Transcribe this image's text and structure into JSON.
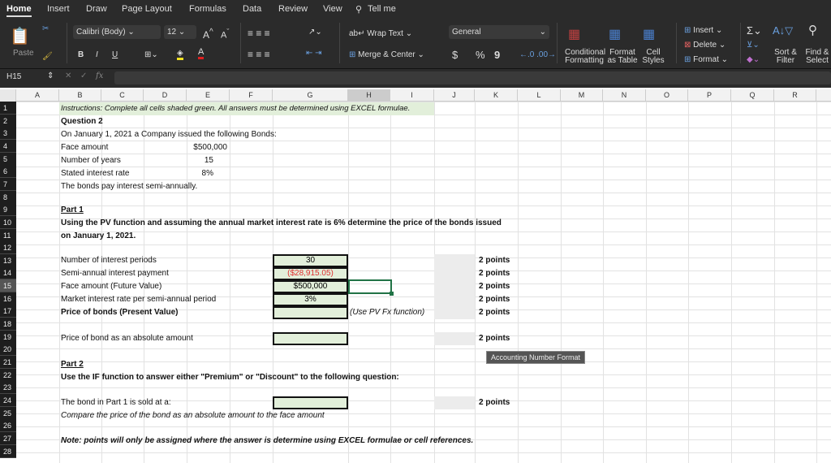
{
  "ribbon": {
    "tabs": [
      "Home",
      "Insert",
      "Draw",
      "Page Layout",
      "Formulas",
      "Data",
      "Review",
      "View"
    ],
    "tell_me": "Tell me",
    "paste": "Paste",
    "font": "Calibri (Body)",
    "size": "12",
    "bold": "B",
    "italic": "I",
    "underline": "U",
    "wrap": "Wrap Text",
    "merge": "Merge & Center",
    "number_format": "General",
    "currency": "$",
    "percent": "%",
    "comma": "9",
    "cond": "Conditional Formatting",
    "fmt_table": "Format as Table",
    "cell_styles": "Cell Styles",
    "insert": "Insert",
    "delete": "Delete",
    "format": "Format",
    "sort": "Sort & Filter",
    "find": "Find & Select"
  },
  "formula_bar": {
    "name_box": "H15",
    "fx": "fx",
    "value": ""
  },
  "columns": [
    "A",
    "B",
    "C",
    "D",
    "E",
    "F",
    "G",
    "H",
    "I",
    "J",
    "K",
    "L",
    "M",
    "N",
    "O",
    "P",
    "Q",
    "R"
  ],
  "selected_cell": "H15",
  "cells": {
    "r1": "Instructions: Complete all cells shaded green. All answers must be determined using EXCEL formulae.",
    "r2": "Question 2",
    "r3": "On January 1, 2021 a Company issued the following Bonds:",
    "r4_label": "Face amount",
    "r4_value": "$500,000",
    "r5_label": "Number of years",
    "r5_value": "15",
    "r6_label": "Stated interest rate",
    "r6_value": "8%",
    "r7": "The bonds pay interest semi-annually.",
    "r9": "Part 1",
    "r10": "Using the PV function and assuming the annual market interest rate is 6% determine the price of the bonds issued",
    "r11": "on January 1, 2021.",
    "r13_label": "Number of interest periods",
    "r13_value": "30",
    "r14_label": "Semi-annual interest payment",
    "r14_value": "($28,915.05)",
    "r15_label": "Face amount (Future Value)",
    "r15_value": "$500,000",
    "r16_label": "Market interest rate per semi-annual period",
    "r16_value": "3%",
    "r17_label": "Price of bonds (Present Value)",
    "r17_note": "(Use PV Fx function)",
    "r19_label": "Price of bond as an absolute amount",
    "r21": "Part 2",
    "r22": "Use the IF function to answer either \"Premium\" or \"Discount\" to the following question:",
    "r24_label": "The bond in Part 1 is sold at a:",
    "r25": "Compare the price of the bond as an absolute amount to the face amount",
    "r27": "Note: points will only be assigned where the answer is determine using EXCEL formulae or cell references.",
    "points": "2 points"
  },
  "tooltip": "Accounting Number Format",
  "colors": {
    "green_fill": "#e2efda",
    "negative": "#e03030",
    "selection": "#217346"
  }
}
